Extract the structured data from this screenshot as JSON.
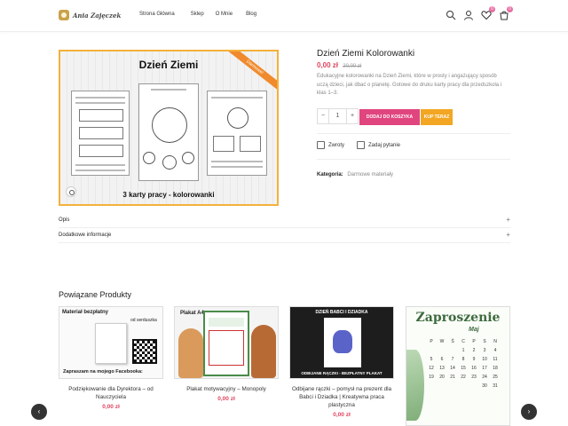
{
  "header": {
    "logo_text": "Ania Zajęczek",
    "nav": [
      "Strona Główna",
      "Sklep",
      "O Mnie",
      "Blog"
    ],
    "wishlist_count": "0",
    "cart_count": "0",
    "icons": [
      "search-icon",
      "user-icon",
      "heart-icon",
      "cart-icon"
    ]
  },
  "product": {
    "image_title": "Dzień Ziemi",
    "image_ribbon": "Darmowe!",
    "image_subtitle": "3 karty pracy - kolorowanki",
    "title": "Dzień Ziemi Kolorowanki",
    "price": "0,00 zł",
    "old_price": "20,00 zł",
    "description": "Edukacyjne kolorowanki na Dzień Ziemi, które w prosty i angażujący sposób uczą dzieci, jak dbać o planetę. Gotowe do druku karty pracy dla przedszkola i klas 1–3.",
    "quantity": "1",
    "add_to_cart": "DODAJ DO KOSZYKA",
    "buy_now": "KUP TERAZ",
    "returns_link": "Zwroty",
    "ask_link": "Zadaj pytanie",
    "category_label": "Kategoria:",
    "category_value": "Darmowe materiały"
  },
  "tabs": [
    {
      "label": "Opis"
    },
    {
      "label": "Dodatkowe informacje"
    }
  ],
  "related": {
    "heading": "Powiązane Produkty",
    "items": [
      {
        "name": "Podziękowanie dla Dyrektora – od Nauczyciela",
        "price": "0,00 zł",
        "img_top": "Materiał bezpłatny",
        "img_side": "od serduszka",
        "img_bottom": "Zapraszam na mojego Facebooka:"
      },
      {
        "name": "Plakat motywacyjny – Monopoly",
        "price": "0,00 zł",
        "img_top": "Plakat A4"
      },
      {
        "name": "Odbijane rączki – pomysł na prezent dla Babci i Dziadka | Kreatywna praca plastyczna",
        "price": "0,00 zł",
        "img_top": "DZIEŃ BABCI I DZIADKA",
        "img_bottom": "ODBIJANE RĄCZKI - BEZPŁATNY PLAKAT"
      },
      {
        "name": "",
        "price": "",
        "img_top": "Zaproszenie",
        "img_sub": "Maj",
        "img_days": [
          "P",
          "W",
          "Ś",
          "C",
          "P",
          "S",
          "N"
        ],
        "img_rows": [
          [
            "",
            "",
            "",
            "1",
            "2",
            "3",
            "4"
          ],
          [
            "5",
            "6",
            "7",
            "8",
            "9",
            "10",
            "11"
          ],
          [
            "12",
            "13",
            "14",
            "15",
            "16",
            "17",
            "18"
          ],
          [
            "19",
            "20",
            "21",
            "22",
            "23",
            "24",
            "25"
          ],
          [
            "",
            "",
            "",
            "",
            "",
            "30",
            "31"
          ]
        ]
      }
    ]
  },
  "colors": {
    "accent_pink": "#e0457e",
    "accent_orange": "#f2a623",
    "price_red": "#e0455e"
  }
}
